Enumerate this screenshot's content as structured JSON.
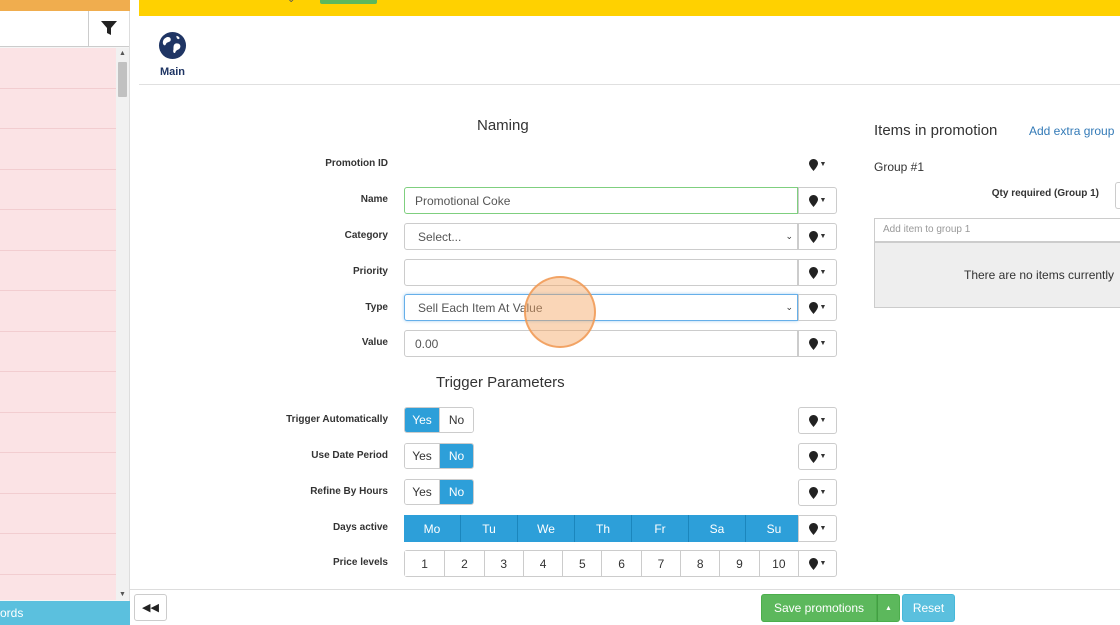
{
  "left_panel": {
    "footer_text": "ords",
    "filter_icon": "filter-icon"
  },
  "main_tab": {
    "label": "Main",
    "icon": "globe-icon"
  },
  "naming": {
    "title": "Naming",
    "promotion_id_label": "Promotion ID",
    "name_label": "Name",
    "name_value": "Promotional Coke",
    "category_label": "Category",
    "category_value": "Select...",
    "priority_label": "Priority",
    "priority_value": "",
    "type_label": "Type",
    "type_value": "Sell Each Item At Value",
    "value_label": "Value",
    "value_value": "0.00"
  },
  "trigger": {
    "title": "Trigger Parameters",
    "trigger_auto_label": "Trigger Automatically",
    "use_date_label": "Use Date Period",
    "refine_hours_label": "Refine By Hours",
    "days_active_label": "Days active",
    "price_levels_label": "Price levels",
    "yes": "Yes",
    "no": "No",
    "trigger_auto_state": "Yes",
    "use_date_state": "No",
    "refine_hours_state": "No",
    "days": [
      "Mo",
      "Tu",
      "We",
      "Th",
      "Fr",
      "Sa",
      "Su"
    ],
    "price_levels": [
      "1",
      "2",
      "3",
      "4",
      "5",
      "6",
      "7",
      "8",
      "9",
      "10"
    ]
  },
  "items": {
    "title": "Items in promotion",
    "add_extra_group": "Add extra group",
    "group_title": "Group #1",
    "qty_label": "Qty required (Group 1)",
    "add_item_placeholder": "Add item to group 1",
    "no_items_text": "There are no items currently"
  },
  "footer": {
    "save_label": "Save promotions",
    "reset_label": "Reset",
    "collapse_icon": "double-chevron-left-icon"
  },
  "colors": {
    "top_bar": "#ffd100",
    "left_top_bar": "#f0ad4e",
    "active_toggle": "#2d9fd9",
    "save": "#5cb85c",
    "reset": "#5bc0de",
    "list_row": "#fbe3e5"
  }
}
